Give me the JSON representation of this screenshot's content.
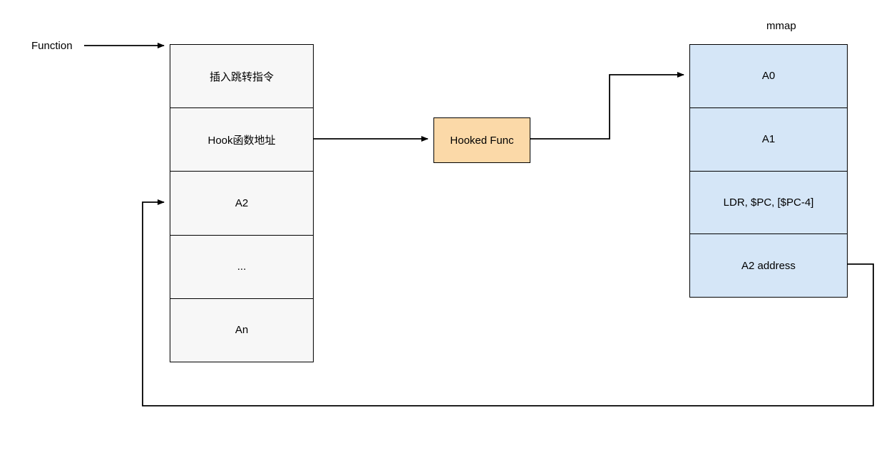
{
  "labels": {
    "function": "Function",
    "mmap": "mmap"
  },
  "left_stack": {
    "cells": [
      "插入跳转指令",
      "Hook函数地址",
      "A2",
      "...",
      "An"
    ]
  },
  "hooked_box": {
    "label": "Hooked Func"
  },
  "right_stack": {
    "cells": [
      "A0",
      "A1",
      "LDR, $PC, [$PC-4]",
      "A2 address"
    ]
  }
}
